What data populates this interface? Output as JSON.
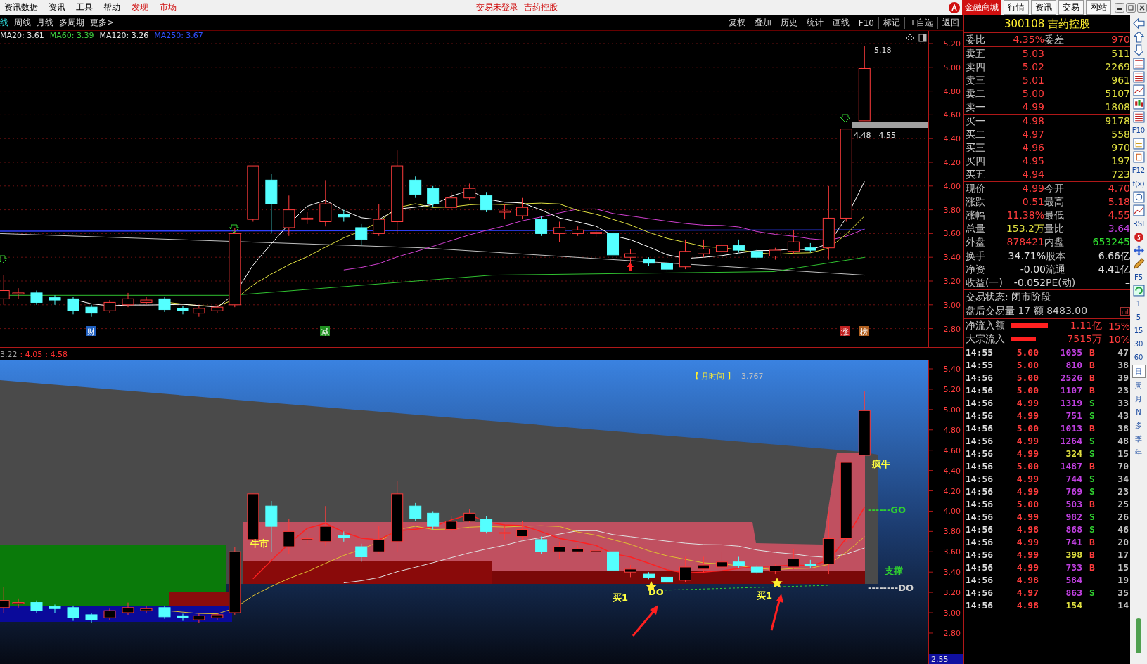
{
  "menu_bar": {
    "items": [
      {
        "label": "资讯数据",
        "highlight": false
      },
      {
        "label": "资讯",
        "highlight": false
      },
      {
        "label": "工具",
        "highlight": false
      },
      {
        "label": "帮助",
        "highlight": false
      },
      {
        "label": "发现",
        "highlight": true
      },
      {
        "label": "市场",
        "highlight": true
      }
    ],
    "title_parts": [
      "交易未登录",
      "吉药控股"
    ],
    "shop_button": "金融商城",
    "nav": [
      "行情",
      "资讯",
      "交易",
      "网站"
    ]
  },
  "period_tabs": [
    {
      "label": "线",
      "selected": true
    },
    {
      "label": "周线",
      "selected": false
    },
    {
      "label": "月线",
      "selected": false
    },
    {
      "label": "多周期",
      "selected": false
    },
    {
      "label": "更多>",
      "selected": false
    }
  ],
  "tools": [
    "复权",
    "叠加",
    "历史",
    "统计",
    "画线",
    "F10",
    "标记",
    "+自选",
    "返回"
  ],
  "ma_legend": [
    {
      "label": "MA20: 3.61",
      "color": "#e8e8e8"
    },
    {
      "label": "MA60: 3.39",
      "color": "#40d040"
    },
    {
      "label": "MA120: 3.26",
      "color": "#e8e8e8"
    },
    {
      "label": "MA250: 3.67",
      "color": "#3050ff"
    }
  ],
  "main_chart": {
    "high_label": "5.18",
    "range_label": "4.48 - 4.55",
    "axis_ticks": [
      "5.20",
      "5.00",
      "4.80",
      "4.60",
      "4.40",
      "4.20",
      "4.00",
      "3.80",
      "3.60",
      "3.40",
      "3.20",
      "3.00",
      "2.80"
    ],
    "markers": [
      {
        "label": "财",
        "color": "#2060c0"
      },
      {
        "label": "减",
        "color": "#209020"
      },
      {
        "label": "涨",
        "color": "#c02020"
      },
      {
        "label": "榜",
        "color": "#b06020"
      }
    ]
  },
  "indicator": {
    "header": [
      {
        "text": "3.22",
        "color": "#a0a0a0"
      },
      {
        "text": ": 4.05",
        "color": "#ff3030"
      },
      {
        "text": ": 4.58",
        "color": "#ff3030"
      }
    ],
    "period_label": "【 月时间 】",
    "value": "-3.767",
    "labels": [
      {
        "text": "牛市",
        "color": "#ffff40"
      },
      {
        "text": "买1",
        "color": "#ffff40"
      },
      {
        "text": "DO",
        "color": "#ffff40"
      },
      {
        "text": "买1",
        "color": "#ffff40"
      },
      {
        "text": "疯牛",
        "color": "#ffff40"
      },
      {
        "text": "------GO",
        "color": "#30d030"
      },
      {
        "text": "支撑",
        "color": "#30d030"
      },
      {
        "text": "--------DO",
        "color": "#d0d0d0"
      }
    ],
    "axis_ticks": [
      "5.40",
      "5.20",
      "5.00",
      "4.80",
      "4.60",
      "4.40",
      "4.20",
      "4.00",
      "3.80",
      "3.60",
      "3.40",
      "3.20",
      "3.00",
      "2.80"
    ],
    "current_value": "2.55"
  },
  "quote": {
    "code": "300108",
    "name": "吉药控股",
    "ratio": {
      "label": "委比",
      "value": "4.35%",
      "label2": "委差",
      "value2": "970"
    },
    "asks": [
      {
        "label": "卖五",
        "price": "5.03",
        "volume": "511"
      },
      {
        "label": "卖四",
        "price": "5.02",
        "volume": "2269"
      },
      {
        "label": "卖三",
        "price": "5.01",
        "volume": "961"
      },
      {
        "label": "卖二",
        "price": "5.00",
        "volume": "5107"
      },
      {
        "label": "卖一",
        "price": "4.99",
        "volume": "1808"
      }
    ],
    "bids": [
      {
        "label": "买一",
        "price": "4.98",
        "volume": "9178"
      },
      {
        "label": "买二",
        "price": "4.97",
        "volume": "558"
      },
      {
        "label": "买三",
        "price": "4.96",
        "volume": "970"
      },
      {
        "label": "买四",
        "price": "4.95",
        "volume": "197"
      },
      {
        "label": "买五",
        "price": "4.94",
        "volume": "723"
      }
    ],
    "stats": [
      {
        "cells": [
          {
            "label": "现价",
            "value": "4.99",
            "color": "#ff3c3c"
          },
          {
            "label": "今开",
            "value": "4.70",
            "color": "#ff3c3c"
          }
        ]
      },
      {
        "cells": [
          {
            "label": "涨跌",
            "value": "0.51",
            "color": "#ff3c3c"
          },
          {
            "label": "最高",
            "value": "5.18",
            "color": "#ff3c3c"
          }
        ]
      },
      {
        "cells": [
          {
            "label": "涨幅",
            "value": "11.38%",
            "color": "#ff3c3c"
          },
          {
            "label": "最低",
            "value": "4.55",
            "color": "#ff3c3c"
          }
        ]
      },
      {
        "cells": [
          {
            "label": "总量",
            "value": "153.2万",
            "color": "#e0e040"
          },
          {
            "label": "量比",
            "value": "3.64",
            "color": "#c040e0"
          }
        ]
      },
      {
        "cells": [
          {
            "label": "外盘",
            "value": "878421",
            "color": "#ff3c3c"
          },
          {
            "label": "内盘",
            "value": "653245",
            "color": "#30e030"
          }
        ]
      }
    ],
    "finance": [
      {
        "label": "换手",
        "value": "34.71%",
        "label2": "股本",
        "value2": "6.66亿"
      },
      {
        "label": "净资",
        "value": "-0.00",
        "label2": "流通",
        "value2": "4.41亿"
      },
      {
        "label": "收益(一)",
        "value": "-0.052",
        "label2": "PE(动)",
        "value2": "–"
      }
    ],
    "status": "交易状态: 闭市阶段",
    "after_hours": "盘后交易量 17 额 8483.00",
    "flows": [
      {
        "label": "净流入额",
        "amount": "1.11亿",
        "percent": "15%"
      },
      {
        "label": "大宗流入",
        "amount": "7515万",
        "percent": "10%"
      }
    ],
    "ticks": [
      {
        "time": "14:55",
        "price": "5.00",
        "volume": "1035",
        "side": "B",
        "kind": "buy",
        "count": "47",
        "color": "#c040e0"
      },
      {
        "time": "14:55",
        "price": "5.00",
        "volume": "810",
        "side": "B",
        "kind": "buy",
        "count": "38",
        "color": "#c040e0"
      },
      {
        "time": "14:56",
        "price": "5.00",
        "volume": "2526",
        "side": "B",
        "kind": "buy",
        "count": "39",
        "color": "#c040e0"
      },
      {
        "time": "14:56",
        "price": "5.00",
        "volume": "1107",
        "side": "B",
        "kind": "buy",
        "count": "23",
        "color": "#c040e0"
      },
      {
        "time": "14:56",
        "price": "4.99",
        "volume": "1319",
        "side": "S",
        "kind": "sell",
        "count": "33",
        "color": "#c040e0"
      },
      {
        "time": "14:56",
        "price": "4.99",
        "volume": "751",
        "side": "S",
        "kind": "sell",
        "count": "43",
        "color": "#c040e0"
      },
      {
        "time": "14:56",
        "price": "5.00",
        "volume": "1013",
        "side": "B",
        "kind": "buy",
        "count": "38",
        "color": "#c040e0"
      },
      {
        "time": "14:56",
        "price": "4.99",
        "volume": "1264",
        "side": "S",
        "kind": "sell",
        "count": "48",
        "color": "#c040e0"
      },
      {
        "time": "14:56",
        "price": "4.99",
        "volume": "324",
        "side": "S",
        "kind": "sell",
        "count": "15",
        "color": "#e0e040"
      },
      {
        "time": "14:56",
        "price": "5.00",
        "volume": "1487",
        "side": "B",
        "kind": "buy",
        "count": "70",
        "color": "#c040e0"
      },
      {
        "time": "14:56",
        "price": "4.99",
        "volume": "744",
        "side": "S",
        "kind": "sell",
        "count": "34",
        "color": "#c040e0"
      },
      {
        "time": "14:56",
        "price": "4.99",
        "volume": "769",
        "side": "S",
        "kind": "sell",
        "count": "23",
        "color": "#c040e0"
      },
      {
        "time": "14:56",
        "price": "5.00",
        "volume": "503",
        "side": "B",
        "kind": "buy",
        "count": "25",
        "color": "#c040e0"
      },
      {
        "time": "14:56",
        "price": "4.99",
        "volume": "982",
        "side": "S",
        "kind": "sell",
        "count": "26",
        "color": "#c040e0"
      },
      {
        "time": "14:56",
        "price": "4.98",
        "volume": "868",
        "side": "S",
        "kind": "sell",
        "count": "46",
        "color": "#c040e0"
      },
      {
        "time": "14:56",
        "price": "4.99",
        "volume": "741",
        "side": "B",
        "kind": "buy",
        "count": "20",
        "color": "#c040e0"
      },
      {
        "time": "14:56",
        "price": "4.99",
        "volume": "398",
        "side": "B",
        "kind": "buy",
        "count": "17",
        "color": "#e0e040"
      },
      {
        "time": "14:56",
        "price": "4.99",
        "volume": "733",
        "side": "B",
        "kind": "buy",
        "count": "15",
        "color": "#c040e0"
      },
      {
        "time": "14:56",
        "price": "4.98",
        "volume": "584",
        "count": "19",
        "color": "#c040e0"
      },
      {
        "time": "14:56",
        "price": "4.97",
        "volume": "863",
        "side": "S",
        "kind": "sell",
        "count": "35",
        "color": "#c040e0"
      },
      {
        "time": "14:56",
        "price": "4.98",
        "volume": "154",
        "count": "14",
        "color": "#e0e040"
      }
    ]
  },
  "side_toolbar": [
    {
      "kind": "icon"
    },
    {
      "kind": "icon"
    },
    {
      "kind": "icon"
    },
    {
      "kind": "icon"
    },
    {
      "kind": "icon"
    },
    {
      "kind": "icon"
    },
    {
      "kind": "icon"
    },
    {
      "kind": "icon"
    },
    {
      "kind": "text",
      "label": "F10",
      "selected": false
    },
    {
      "kind": "icon"
    },
    {
      "kind": "icon"
    },
    {
      "kind": "text",
      "label": "F12",
      "selected": false
    },
    {
      "kind": "text",
      "label": "f(x)",
      "selected": false
    },
    {
      "kind": "icon"
    },
    {
      "kind": "icon"
    },
    {
      "kind": "text",
      "label": "RSI",
      "selected": false
    },
    {
      "kind": "icon"
    },
    {
      "kind": "icon"
    },
    {
      "kind": "icon"
    },
    {
      "kind": "text",
      "label": "F5",
      "selected": false
    },
    {
      "kind": "icon"
    },
    {
      "kind": "text",
      "label": "1",
      "selected": false
    },
    {
      "kind": "text",
      "label": "5",
      "selected": false
    },
    {
      "kind": "text",
      "label": "15",
      "selected": false
    },
    {
      "kind": "text",
      "label": "30",
      "selected": false
    },
    {
      "kind": "text",
      "label": "60",
      "selected": false
    },
    {
      "kind": "text",
      "label": "日",
      "selected": true
    },
    {
      "kind": "text",
      "label": "周",
      "selected": false
    },
    {
      "kind": "text",
      "label": "月",
      "selected": false
    },
    {
      "kind": "text",
      "label": "N",
      "selected": false
    },
    {
      "kind": "text",
      "label": "多",
      "selected": false
    },
    {
      "kind": "text",
      "label": "季",
      "selected": false
    },
    {
      "kind": "text",
      "label": "年",
      "selected": false
    }
  ]
}
